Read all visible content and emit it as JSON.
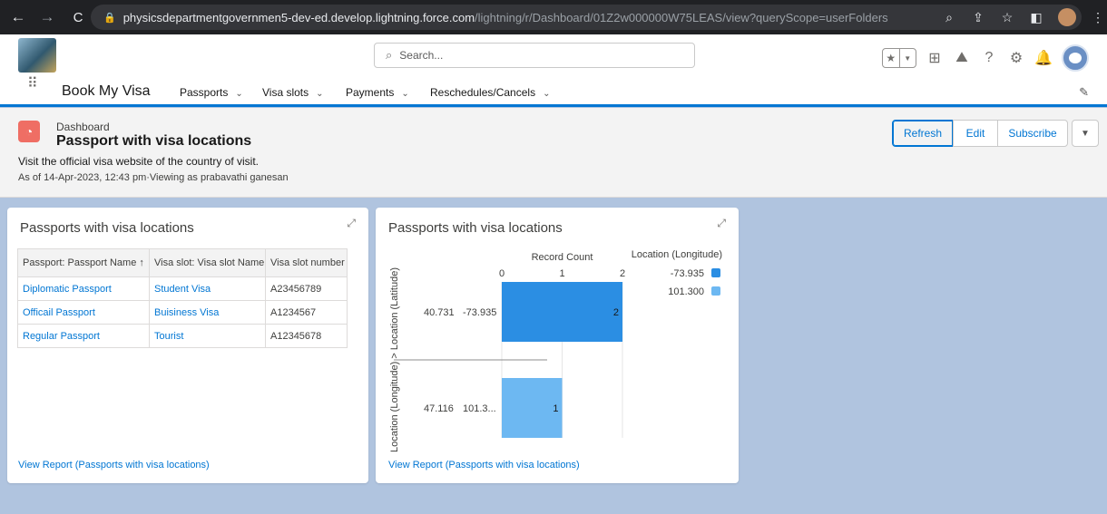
{
  "browser": {
    "url_host": "physicsdepartmentgovernmen5-dev-ed.develop.lightning.force.com",
    "url_path": "/lightning/r/Dashboard/01Z2w000000W75LEAS/view?queryScope=userFolders"
  },
  "header": {
    "search_placeholder": "Search..."
  },
  "app": {
    "name": "Book My Visa",
    "nav": [
      "Passports",
      "Visa slots",
      "Payments",
      "Reschedules/Cancels"
    ]
  },
  "dashboard": {
    "label": "Dashboard",
    "title": "Passport with visa locations",
    "description": "Visit the official visa website of the country of visit.",
    "meta": "As of 14-Apr-2023, 12:43 pm·Viewing as prabavathi ganesan",
    "buttons": {
      "refresh": "Refresh",
      "edit": "Edit",
      "subscribe": "Subscribe"
    }
  },
  "table_widget": {
    "title": "Passports with visa locations",
    "columns": [
      "Passport: Passport Name ↑",
      "Visa slot: Visa slot Name",
      "Visa slot number"
    ],
    "rows": [
      [
        "Diplomatic Passport",
        "Student Visa",
        "A23456789"
      ],
      [
        "Officail Passport",
        "Buisiness Visa",
        "A1234567"
      ],
      [
        "Regular Passport",
        "Tourist",
        "A12345678"
      ]
    ],
    "view_report": "View Report (Passports with visa locations)"
  },
  "chart_widget": {
    "title": "Passports with visa locations",
    "view_report": "View Report (Passports with visa locations)"
  },
  "chart_data": {
    "type": "bar",
    "orientation": "horizontal",
    "xlabel": "Record Count",
    "ylabel": "Location (Longitude) > Location (Latitude)",
    "xlim": [
      0,
      2
    ],
    "xticks": [
      0,
      1,
      2
    ],
    "legend_title": "Location (Longitude)",
    "legend_position": "top-right",
    "categories": [
      {
        "latitude": "40.731",
        "longitude": "-73.935",
        "value": 2,
        "color": "#2b8ee3"
      },
      {
        "latitude": "47.116",
        "longitude": "101.3...",
        "value": 1,
        "color": "#6db8f2"
      }
    ],
    "legend": [
      {
        "label": "-73.935",
        "color": "#2b8ee3"
      },
      {
        "label": "101.300",
        "color": "#6db8f2"
      }
    ]
  }
}
